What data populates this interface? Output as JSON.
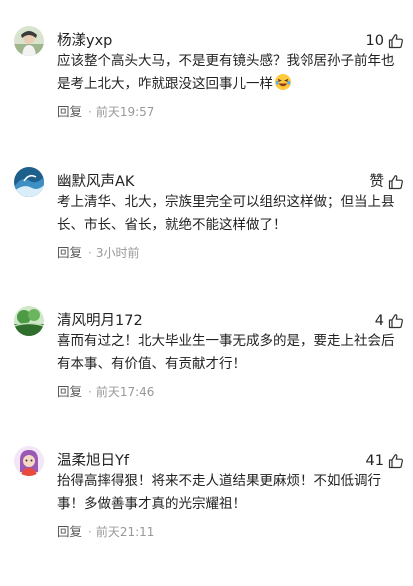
{
  "comments": [
    {
      "username": "杨漾yxp",
      "likes": "10",
      "content": "应该整个高头大马，不是更有镜头感？我邻居孙子前年也是考上北大，咋就跟没这回事儿一样",
      "emoji": "laughing-emoji",
      "reply": "回复",
      "separator": "·",
      "time": "前天19:57"
    },
    {
      "username": "幽默风声AK",
      "likes": "赞",
      "content": "考上清华、北大，宗族里完全可以组织这样做；但当上县长、市长、省长，就绝不能这样做了！",
      "reply": "回复",
      "separator": "·",
      "time": "3小时前"
    },
    {
      "username": "清风明月172",
      "likes": "4",
      "content": "喜而有过之！北大毕业生一事无成多的是，要走上社会后有本事、有价值、有贡献才行！",
      "reply": "回复",
      "separator": "·",
      "time": "前天17:46"
    },
    {
      "username": "温柔旭日Yf",
      "likes": "41",
      "content": "抬得高摔得狠！将来不走人道结果更麻烦！不如低调行事！多做善事才真的光宗耀祖！",
      "reply": "回复",
      "separator": "·",
      "time": "前天21:11"
    }
  ],
  "icons": {
    "like": "thumbs-up-icon"
  },
  "colors": {
    "text": "#222222",
    "meta": "#999999",
    "background": "#ffffff"
  }
}
